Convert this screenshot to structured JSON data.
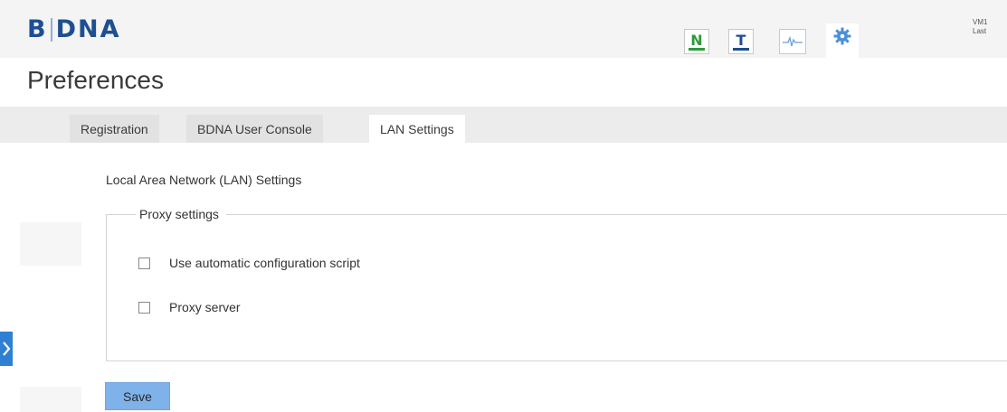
{
  "header": {
    "logo_left": "B",
    "logo_right": "DNA",
    "icons": [
      {
        "name": "normalize-icon",
        "letter": "N",
        "color": "#2e9a3d"
      },
      {
        "name": "technopedia-icon",
        "letter": "T",
        "color": "#1d4f91"
      },
      {
        "name": "pulse-icon"
      },
      {
        "name": "gear-icon",
        "color": "#4a90d9"
      }
    ],
    "user_line1": "VM1",
    "user_line2": "Last"
  },
  "page": {
    "title": "Preferences"
  },
  "tabs": [
    {
      "label": "Registration",
      "active": false
    },
    {
      "label": "BDNA User Console",
      "active": false
    },
    {
      "label": "LAN Settings",
      "active": true
    }
  ],
  "lan": {
    "section_title": "Local Area Network (LAN) Settings",
    "legend": "Proxy settings",
    "options": [
      {
        "label": "Use automatic configuration script",
        "checked": false
      },
      {
        "label": "Proxy server",
        "checked": false
      }
    ],
    "save_label": "Save"
  },
  "colors": {
    "brand": "#1d4f91",
    "accent": "#2f80d4",
    "save_button": "#7fb2e8"
  }
}
